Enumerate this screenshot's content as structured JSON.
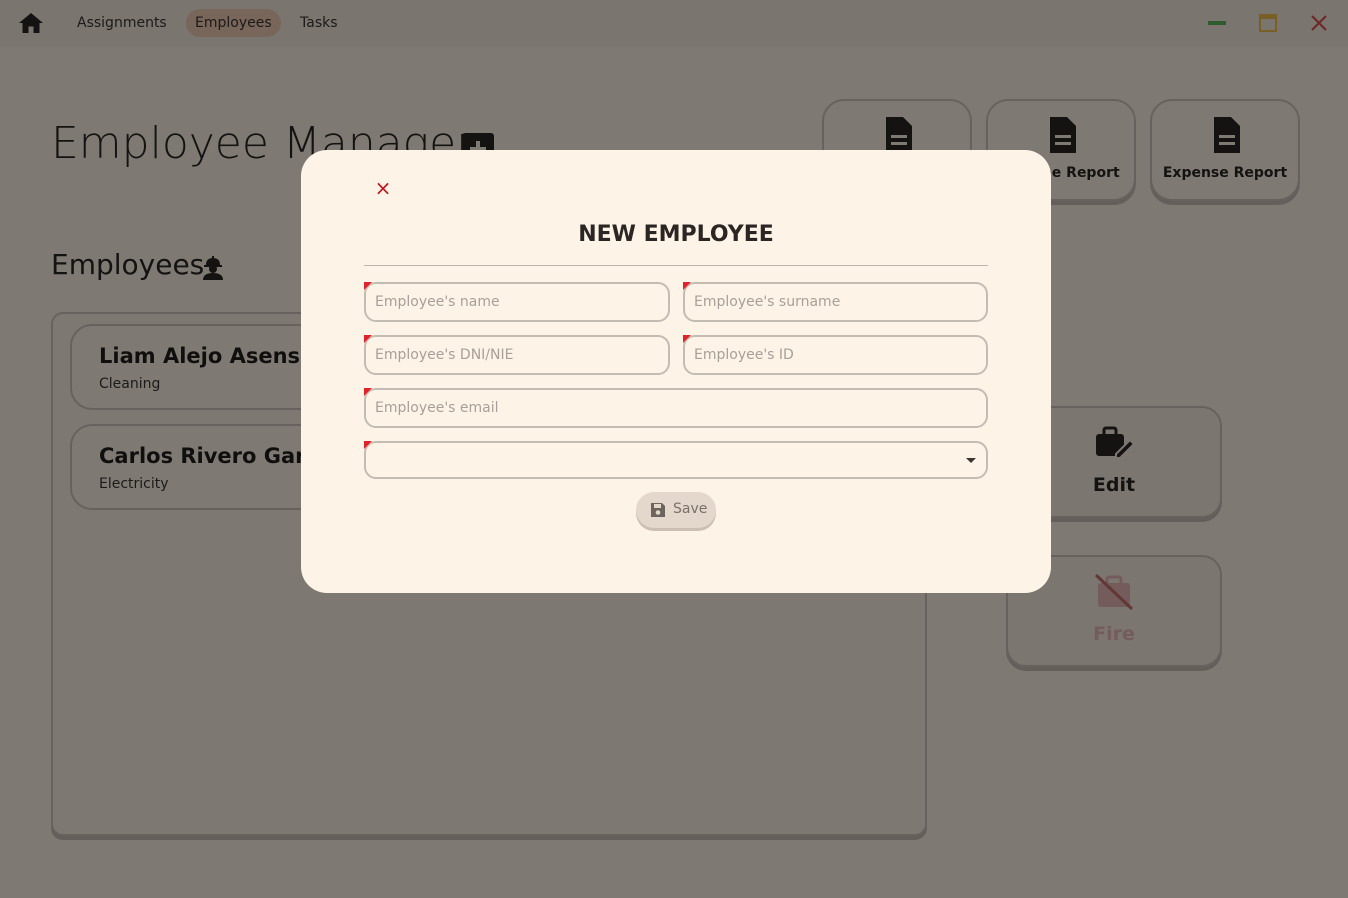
{
  "nav": {
    "items": [
      {
        "label": "Assignments"
      },
      {
        "label": "Employees",
        "active": true
      },
      {
        "label": "Tasks"
      }
    ]
  },
  "window_controls": {
    "minimize_color": "#5cb85c",
    "maximize_color": "#f0c04a",
    "close_color": "#d9534f"
  },
  "page": {
    "title": "Employee Manager"
  },
  "reports": [
    {
      "label": ""
    },
    {
      "label": "ee Report"
    },
    {
      "label": "Expense Report"
    }
  ],
  "employees_section": {
    "title": "Employees",
    "list": [
      {
        "name": "Liam Alejo Asensi",
        "department": "Cleaning"
      },
      {
        "name": "Carlos Rivero García",
        "department": "Electricity"
      }
    ]
  },
  "actions": {
    "edit_label": "Edit",
    "fire_label": "Fire"
  },
  "colors": {
    "accent": "#f1cdb4",
    "required_mark": "#e0232b",
    "danger": "#c0161e",
    "overlay": "rgba(0,0,0,0.5)"
  },
  "modal": {
    "close_symbol": "×",
    "title": "NEW EMPLOYEE",
    "fields": {
      "name_placeholder": "Employee's name",
      "surname_placeholder": "Employee's surname",
      "dni_placeholder": "Employee's DNI/NIE",
      "id_placeholder": "Employee's ID",
      "email_placeholder": "Employee's email",
      "department_value": ""
    },
    "save_label": "Save"
  }
}
